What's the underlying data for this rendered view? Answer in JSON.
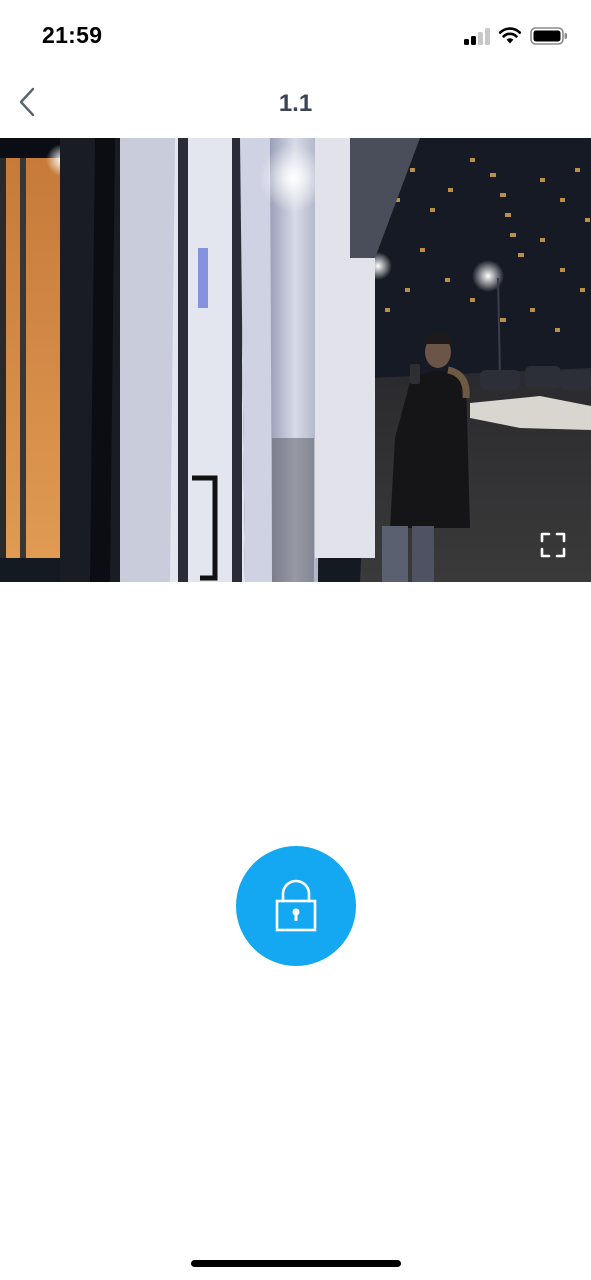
{
  "status_bar": {
    "time": "21:59",
    "icons": [
      "cellular-signal-icon",
      "wifi-icon",
      "battery-icon"
    ]
  },
  "nav": {
    "back_icon": "chevron-left-icon",
    "title": "1.1"
  },
  "video": {
    "content": "doorbell-camera-live-feed",
    "fullscreen_icon": "fullscreen-icon"
  },
  "unlock": {
    "icon": "padlock-icon",
    "color": "#14a8f3"
  },
  "colors": {
    "accent": "#14a8f3",
    "title": "#3a4452",
    "background": "#ffffff"
  }
}
